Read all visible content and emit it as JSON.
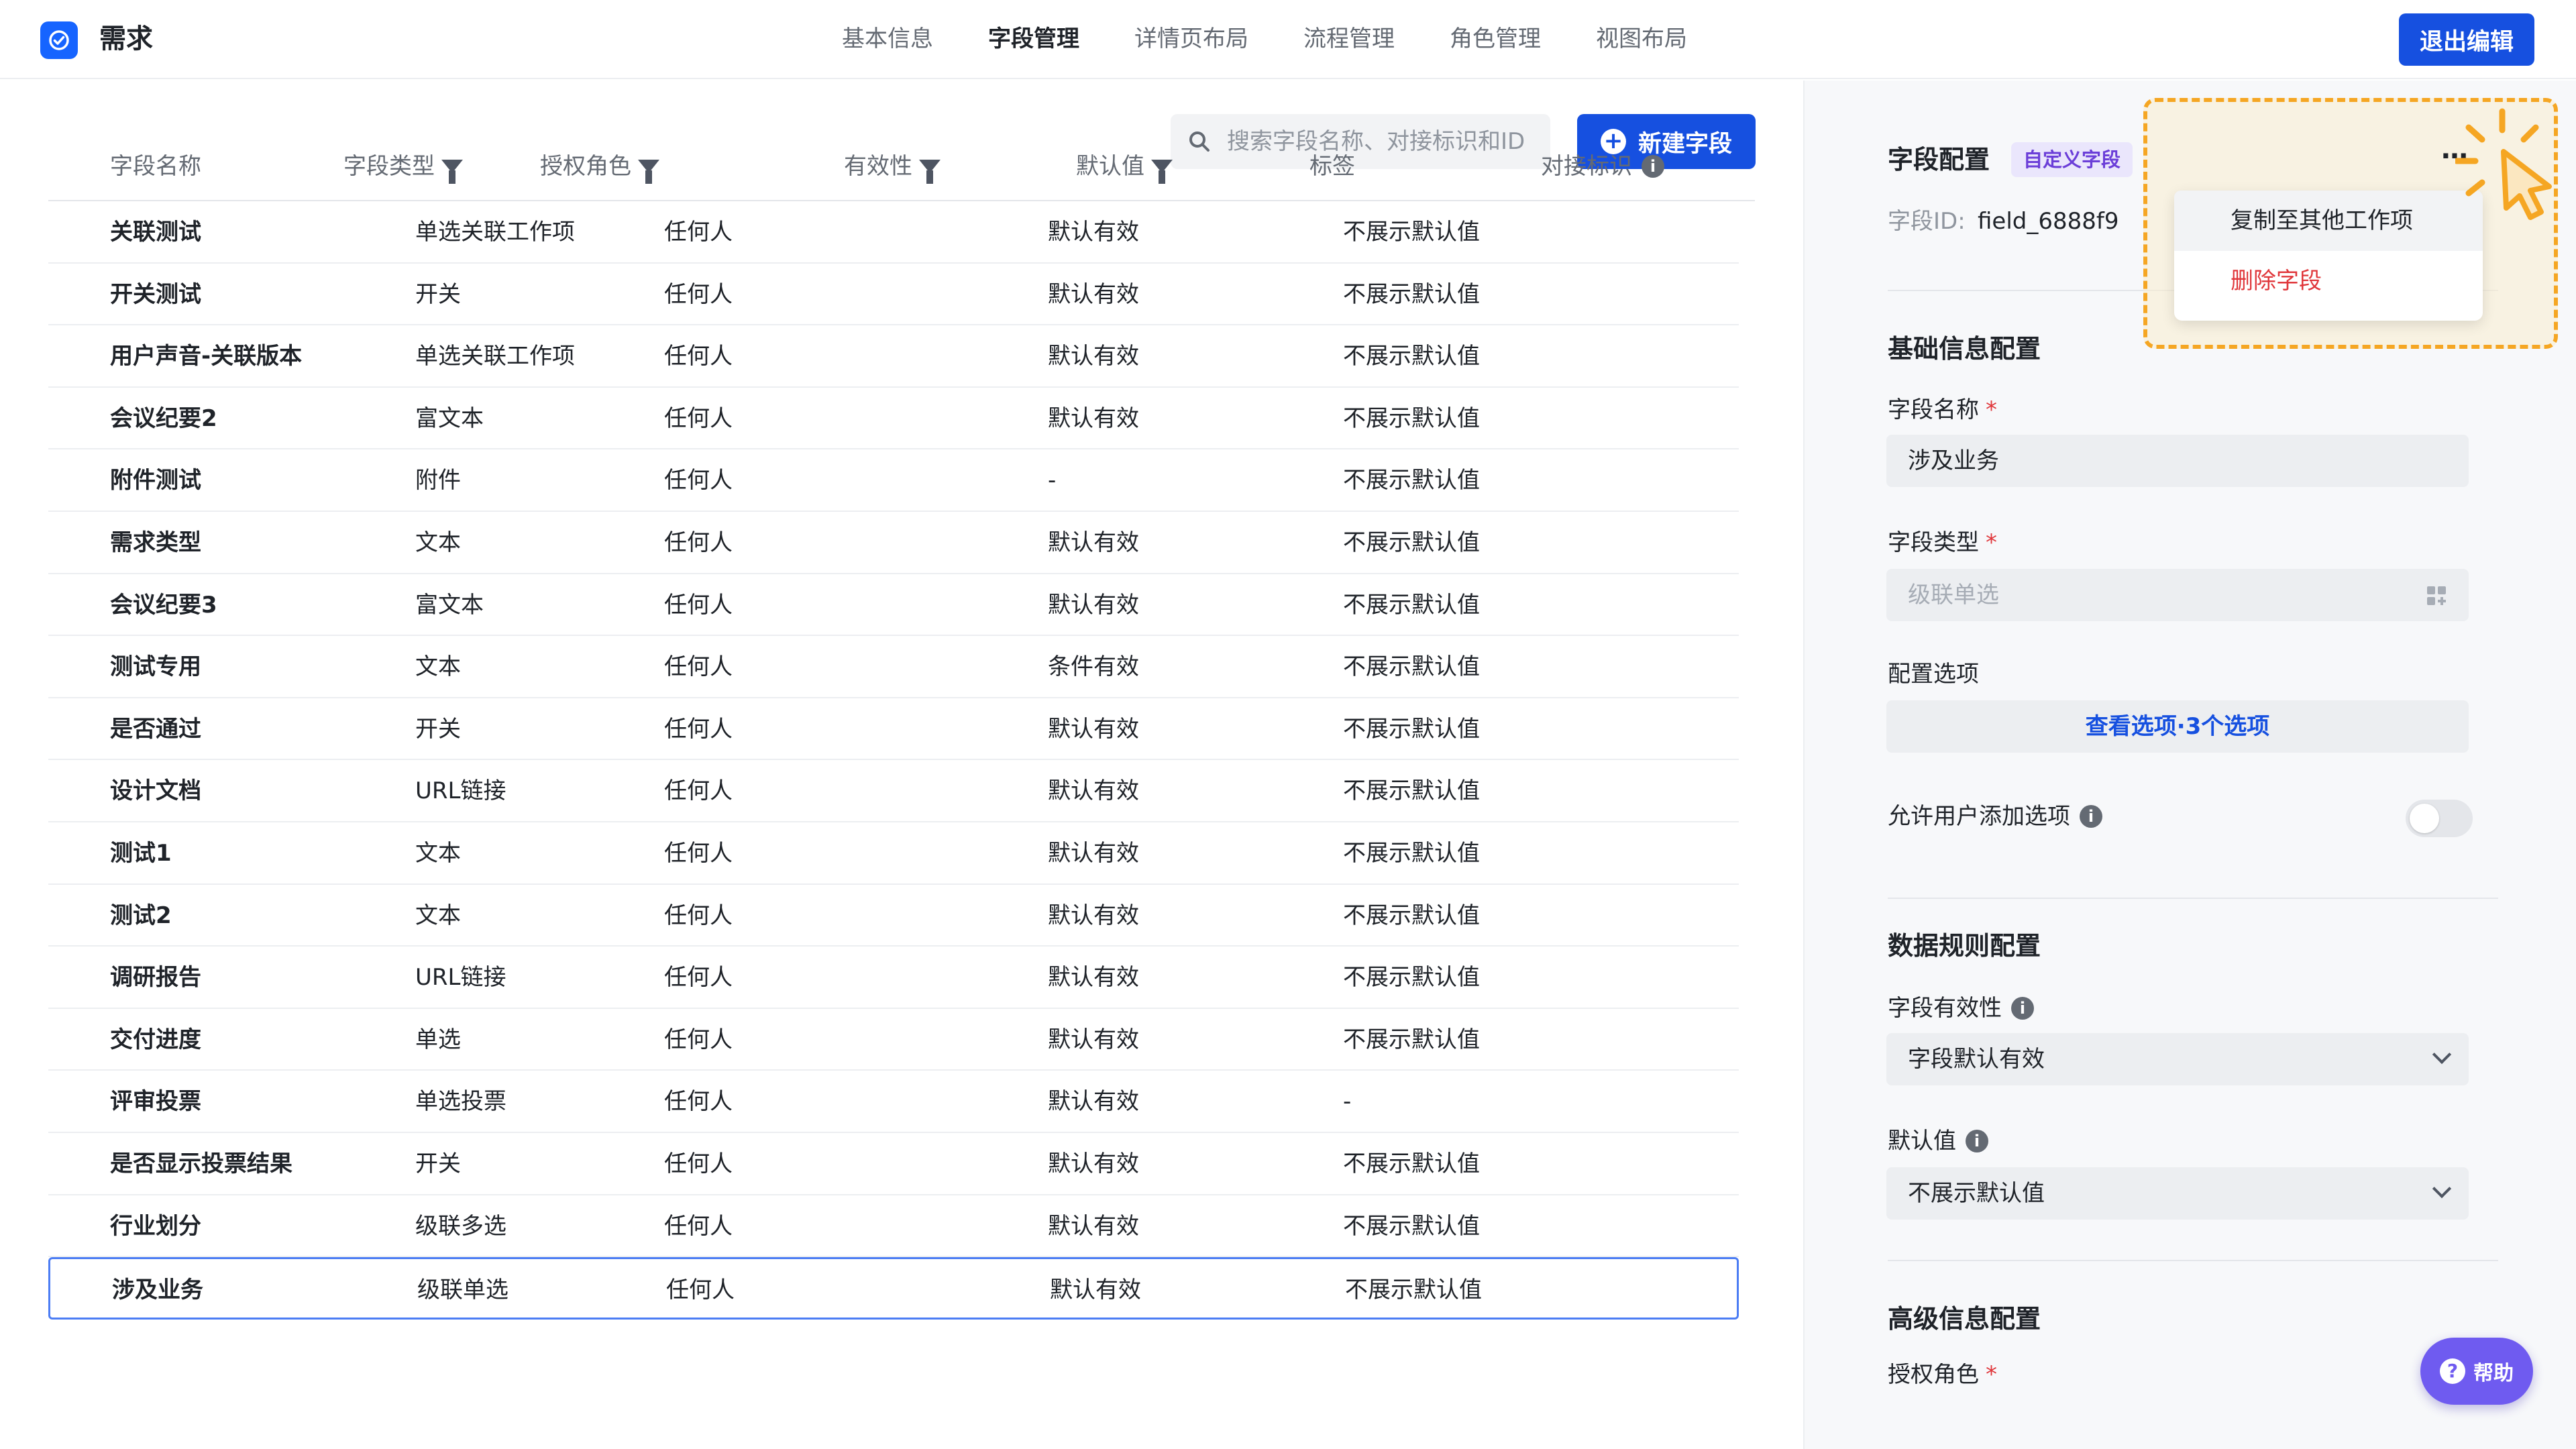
{
  "header": {
    "app_title": "需求",
    "nav": [
      "基本信息",
      "字段管理",
      "详情页布局",
      "流程管理",
      "角色管理",
      "视图布局"
    ],
    "active_nav": "字段管理",
    "exit_label": "退出编辑"
  },
  "toolbar": {
    "search_placeholder": "搜索字段名称、对接标识和ID",
    "new_field_label": "新建字段"
  },
  "table": {
    "columns": [
      "字段名称",
      "字段类型",
      "授权角色",
      "有效性",
      "默认值",
      "标签",
      "对接标识"
    ],
    "rows": [
      {
        "name": "关联测试",
        "type": "单选关联工作项",
        "role": "任何人",
        "validity": "默认有效",
        "default": "不展示默认值"
      },
      {
        "name": "开关测试",
        "type": "开关",
        "role": "任何人",
        "validity": "默认有效",
        "default": "不展示默认值"
      },
      {
        "name": "用户声音-关联版本",
        "type": "单选关联工作项",
        "role": "任何人",
        "validity": "默认有效",
        "default": "不展示默认值"
      },
      {
        "name": "会议纪要2",
        "type": "富文本",
        "role": "任何人",
        "validity": "默认有效",
        "default": "不展示默认值"
      },
      {
        "name": "附件测试",
        "type": "附件",
        "role": "任何人",
        "validity": "-",
        "default": "不展示默认值"
      },
      {
        "name": "需求类型",
        "type": "文本",
        "role": "任何人",
        "validity": "默认有效",
        "default": "不展示默认值"
      },
      {
        "name": "会议纪要3",
        "type": "富文本",
        "role": "任何人",
        "validity": "默认有效",
        "default": "不展示默认值"
      },
      {
        "name": "测试专用",
        "type": "文本",
        "role": "任何人",
        "validity": "条件有效",
        "default": "不展示默认值"
      },
      {
        "name": "是否通过",
        "type": "开关",
        "role": "任何人",
        "validity": "默认有效",
        "default": "不展示默认值"
      },
      {
        "name": "设计文档",
        "type": "URL链接",
        "role": "任何人",
        "validity": "默认有效",
        "default": "不展示默认值"
      },
      {
        "name": "测试1",
        "type": "文本",
        "role": "任何人",
        "validity": "默认有效",
        "default": "不展示默认值"
      },
      {
        "name": "测试2",
        "type": "文本",
        "role": "任何人",
        "validity": "默认有效",
        "default": "不展示默认值"
      },
      {
        "name": "调研报告",
        "type": "URL链接",
        "role": "任何人",
        "validity": "默认有效",
        "default": "不展示默认值"
      },
      {
        "name": "交付进度",
        "type": "单选",
        "role": "任何人",
        "validity": "默认有效",
        "default": "不展示默认值"
      },
      {
        "name": "评审投票",
        "type": "单选投票",
        "role": "任何人",
        "validity": "默认有效",
        "default": "-"
      },
      {
        "name": "是否显示投票结果",
        "type": "开关",
        "role": "任何人",
        "validity": "默认有效",
        "default": "不展示默认值"
      },
      {
        "name": "行业划分",
        "type": "级联多选",
        "role": "任何人",
        "validity": "默认有效",
        "default": "不展示默认值"
      },
      {
        "name": "涉及业务",
        "type": "级联单选",
        "role": "任何人",
        "validity": "默认有效",
        "default": "不展示默认值"
      }
    ]
  },
  "panel": {
    "title": "字段配置",
    "badge": "自定义字段",
    "id_label": "字段ID:",
    "id_value": "field_6888f9",
    "menu": [
      "复制至其他工作项",
      "删除字段"
    ],
    "basic_title": "基础信息配置",
    "name_label": "字段名称",
    "name_value": "涉及业务",
    "type_label": "字段类型",
    "type_value": "级联单选",
    "options_label": "配置选项",
    "options_link": "查看选项·3个选项",
    "allow_add_label": "允许用户添加选项",
    "allow_add_on": false,
    "rules_title": "数据规则配置",
    "validity_label": "字段有效性",
    "validity_value": "字段默认有效",
    "default_label": "默认值",
    "default_value": "不展示默认值",
    "advanced_title": "高级信息配置",
    "role_label": "授权角色",
    "required_mark": "*"
  },
  "help_label": "帮助",
  "colors": {
    "primary": "#1650e0",
    "accent_purple": "#6f5bf0",
    "danger": "#e0373b",
    "highlight": "#f5a623"
  }
}
